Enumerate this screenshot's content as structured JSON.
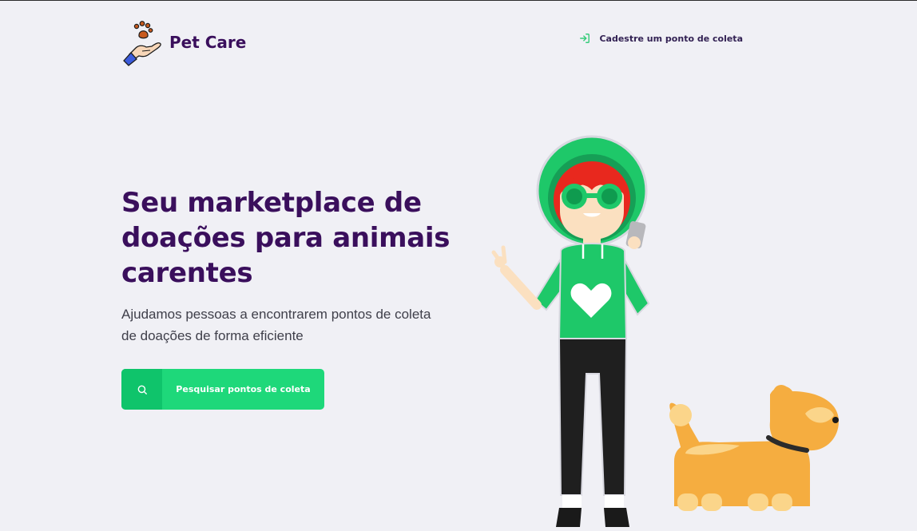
{
  "brand": {
    "name": "Pet Care",
    "logo_icon": "paw-hand-icon"
  },
  "header": {
    "register_link": {
      "label": "Cadestre um ponto de coleta",
      "icon": "log-in-icon"
    }
  },
  "hero": {
    "title": "Seu marketplace de doações para animais carentes",
    "description": "Ajudamos pessoas a encontrarem pontos de coleta de doações de forma eficiente",
    "search_button": {
      "label": "Pesquisar pontos de coleta",
      "icon": "search-icon"
    }
  },
  "colors": {
    "background": "#f0f0f5",
    "title": "#3a0f5c",
    "accent": "#1ed87a",
    "accent_dark": "#0fc46b",
    "link_icon": "#34cb79"
  }
}
